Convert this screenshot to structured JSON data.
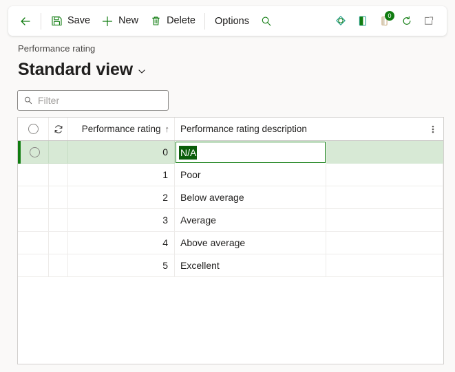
{
  "toolbar": {
    "back_label": "Back",
    "items": [
      {
        "icon": "save-icon",
        "label": "Save"
      },
      {
        "icon": "add-icon",
        "label": "New"
      },
      {
        "icon": "delete-icon",
        "label": "Delete"
      }
    ],
    "options_label": "Options",
    "search_icon": "search-icon",
    "right_icons": [
      {
        "name": "personalize-icon"
      },
      {
        "name": "help-pane-icon"
      },
      {
        "name": "notifications-icon",
        "badge": "0"
      },
      {
        "name": "refresh-icon"
      },
      {
        "name": "open-in-new-window-icon"
      }
    ]
  },
  "page": {
    "breadcrumb": "Performance rating",
    "title": "Standard view",
    "title_chevron": "chevron-down-icon"
  },
  "filter": {
    "icon": "search-icon",
    "placeholder": "Filter",
    "value": ""
  },
  "grid": {
    "select_all_icon": "select-all-circle-icon",
    "refresh_column_icon": "refresh-icon",
    "columns": [
      {
        "key": "rating",
        "label": "Performance rating",
        "sort": "ascending",
        "sort_glyph": "↑"
      },
      {
        "key": "description",
        "label": "Performance rating description"
      }
    ],
    "overflow_icon": "more-vertical-icon",
    "rows": [
      {
        "rating": "0",
        "description": "N/A",
        "selected": true,
        "editing": true
      },
      {
        "rating": "1",
        "description": "Poor",
        "selected": false,
        "editing": false
      },
      {
        "rating": "2",
        "description": "Below average",
        "selected": false,
        "editing": false
      },
      {
        "rating": "3",
        "description": "Average",
        "selected": false,
        "editing": false
      },
      {
        "rating": "4",
        "description": "Above average",
        "selected": false,
        "editing": false
      },
      {
        "rating": "5",
        "description": "Excellent",
        "selected": false,
        "editing": false
      }
    ]
  },
  "colors": {
    "accent_green": "#107c10",
    "selection_green": "#0b5d0b",
    "selected_row_bg": "#d7e9d5",
    "page_bg": "#faf9f8"
  }
}
